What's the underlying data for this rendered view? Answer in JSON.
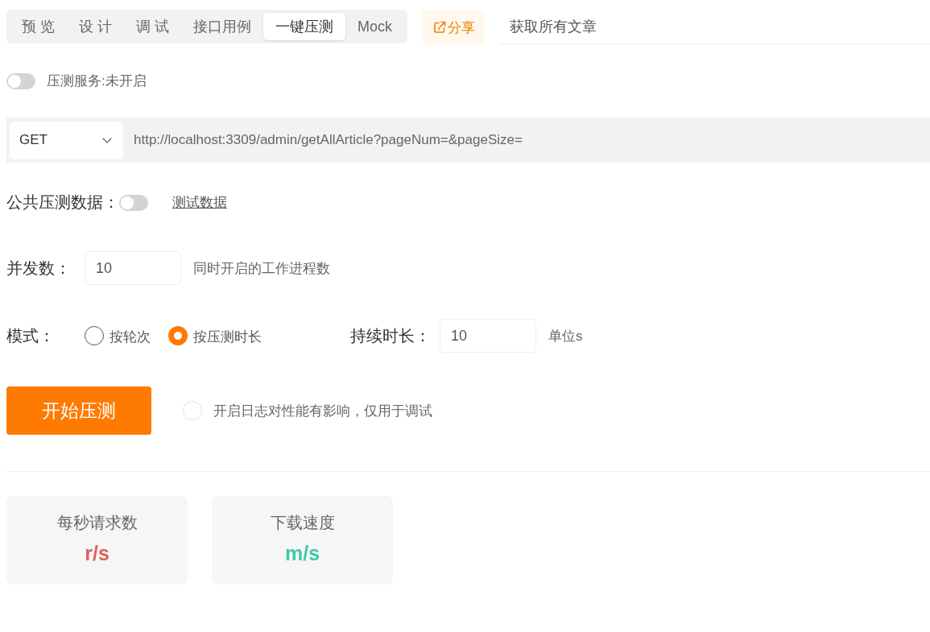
{
  "tabs": [
    {
      "label": "预 览",
      "selected": false
    },
    {
      "label": "设 计",
      "selected": false
    },
    {
      "label": "调 试",
      "selected": false
    },
    {
      "label": "接口用例",
      "selected": false
    },
    {
      "label": "一键压测",
      "selected": true
    },
    {
      "label": "Mock",
      "selected": false
    }
  ],
  "share_button": {
    "label": "分享"
  },
  "api_title": "获取所有文章",
  "service_switch": {
    "on": false,
    "label": "压测服务:未开启"
  },
  "request": {
    "method": "GET",
    "url": "http://localhost:3309/admin/getAllArticle?pageNum=&pageSize="
  },
  "public_data": {
    "label": "公共压测数据：",
    "on": false,
    "link": "测试数据"
  },
  "concurrency": {
    "label": "并发数：",
    "value": "10",
    "hint": "同时开启的工作进程数"
  },
  "mode": {
    "label": "模式：",
    "options": [
      {
        "label": "按轮次",
        "selected": false
      },
      {
        "label": "按压测时长",
        "selected": true
      }
    ]
  },
  "duration": {
    "label": "持续时长：",
    "value": "10",
    "unit": "单位s"
  },
  "start_button": {
    "label": "开始压测"
  },
  "log_option": {
    "checked": false,
    "label": "开启日志对性能有影响，仅用于调试"
  },
  "stats": [
    {
      "title": "每秒请求数",
      "value": "r/s",
      "color": "#e0605c"
    },
    {
      "title": "下载速度",
      "value": "m/s",
      "color": "#3ccca4"
    }
  ]
}
